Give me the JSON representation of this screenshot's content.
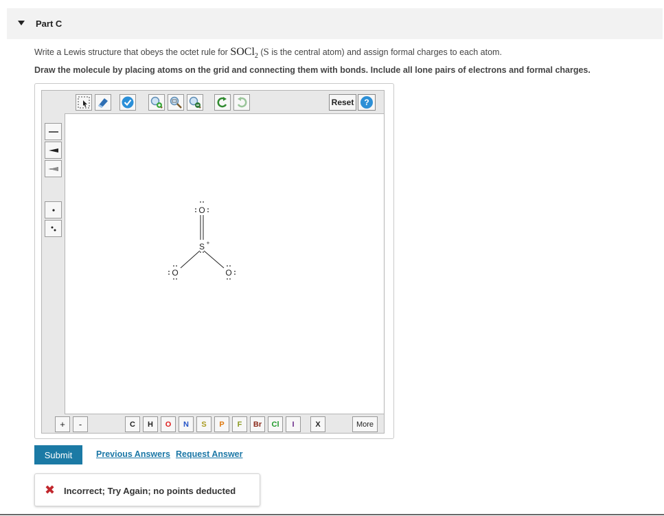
{
  "part": {
    "title": "Part C"
  },
  "question": {
    "prefix": "Write a Lewis structure that obeys the octet rule for ",
    "formula": "SOCl",
    "formula_sub": "2",
    "middle": " (",
    "central_atom": "S",
    "suffix": " is the central atom) and assign formal charges to each atom."
  },
  "instruction": "Draw the molecule by placing atoms on the grid and connecting them with bonds. Include all lone pairs of electrons and formal charges.",
  "toolbar": {
    "reset_label": "Reset",
    "help_label": "?"
  },
  "molecule": {
    "top_atom": "O",
    "center_atom": "S",
    "center_charge": "+",
    "left_atom": "O",
    "right_atom": "O"
  },
  "charges": {
    "plus": "+",
    "minus": "-"
  },
  "atoms": [
    {
      "symbol": "C",
      "color": "#222222"
    },
    {
      "symbol": "H",
      "color": "#222222"
    },
    {
      "symbol": "O",
      "color": "#e02020"
    },
    {
      "symbol": "N",
      "color": "#2453c7"
    },
    {
      "symbol": "S",
      "color": "#a99a20"
    },
    {
      "symbol": "P",
      "color": "#e07a10"
    },
    {
      "symbol": "F",
      "color": "#8a9a20"
    },
    {
      "symbol": "Br",
      "color": "#8a2a1a"
    },
    {
      "symbol": "Cl",
      "color": "#1f9a2a"
    },
    {
      "symbol": "I",
      "color": "#6a2a8a"
    },
    {
      "symbol": "X",
      "color": "#222222"
    }
  ],
  "more_label": "More",
  "actions": {
    "submit": "Submit",
    "previous_answers": "Previous Answers",
    "request_answer": "Request Answer"
  },
  "feedback": {
    "message": "Incorrect; Try Again; no points deducted",
    "status_color": "#c1272d"
  }
}
